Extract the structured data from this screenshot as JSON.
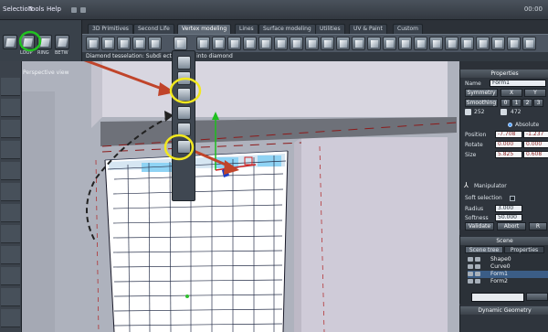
{
  "menubar": {
    "items": [
      "Selection",
      "Tools",
      "Help"
    ],
    "clock": "00:00"
  },
  "left_toolbar": {
    "labels": [
      "LOOP",
      "RING",
      "BETW"
    ]
  },
  "tabs": [
    {
      "label": "3D Primitives",
      "active": false
    },
    {
      "label": "Second Life",
      "active": false
    },
    {
      "label": "Vertex modeling",
      "active": true
    },
    {
      "label": "Lines",
      "active": false
    },
    {
      "label": "Surface modeling",
      "active": false
    },
    {
      "label": "Utilities",
      "active": false
    },
    {
      "label": "UV & Paint",
      "active": false
    },
    {
      "label": "Custom",
      "active": false
    }
  ],
  "hint": "Diamond tesselation: Subdi         ected faces into diamond",
  "viewport": {
    "title": "Perspective view"
  },
  "properties": {
    "title": "Properties",
    "name_label": "Name",
    "name_value": "Form1",
    "symmetry_label": "Symmetry",
    "axes": [
      "X",
      "Y"
    ],
    "smoothing_label": "Smoothing",
    "smoothing_values": [
      "0",
      "1",
      "2",
      "3"
    ],
    "vertex_count": "252",
    "face_count": "472",
    "absolute_label": "Absolute",
    "position_label": "Position",
    "position": [
      "-7.708",
      "-1.237"
    ],
    "rotate_label": "Rotate",
    "rotate": [
      "0.000",
      "0.000"
    ],
    "size_label": "Size",
    "size": [
      "5.825",
      "0.608"
    ],
    "manipulator_label": "Manipulator",
    "soft_selection_label": "Soft selection",
    "radius_label": "Radius",
    "radius_value": "3.000",
    "softness_label": "Softness",
    "softness_value": "50.000",
    "validate_label": "Validate",
    "abort_label": "Abort",
    "reset_label": "R"
  },
  "scene": {
    "title": "Scene",
    "tab_tree": "Scene tree",
    "tab_props": "Properties",
    "items": [
      {
        "name": "Shape0",
        "selected": false
      },
      {
        "name": "Curve0",
        "selected": false
      },
      {
        "name": "Form1",
        "selected": true
      },
      {
        "name": "Form2",
        "selected": false
      }
    ]
  },
  "dynamic": {
    "title": "Dynamic Geometry"
  },
  "colors": {
    "annotation_red": "#c0442a",
    "annotation_yellow": "#f2e81e",
    "annotation_green": "#21c221",
    "annotation_black": "#222222"
  }
}
